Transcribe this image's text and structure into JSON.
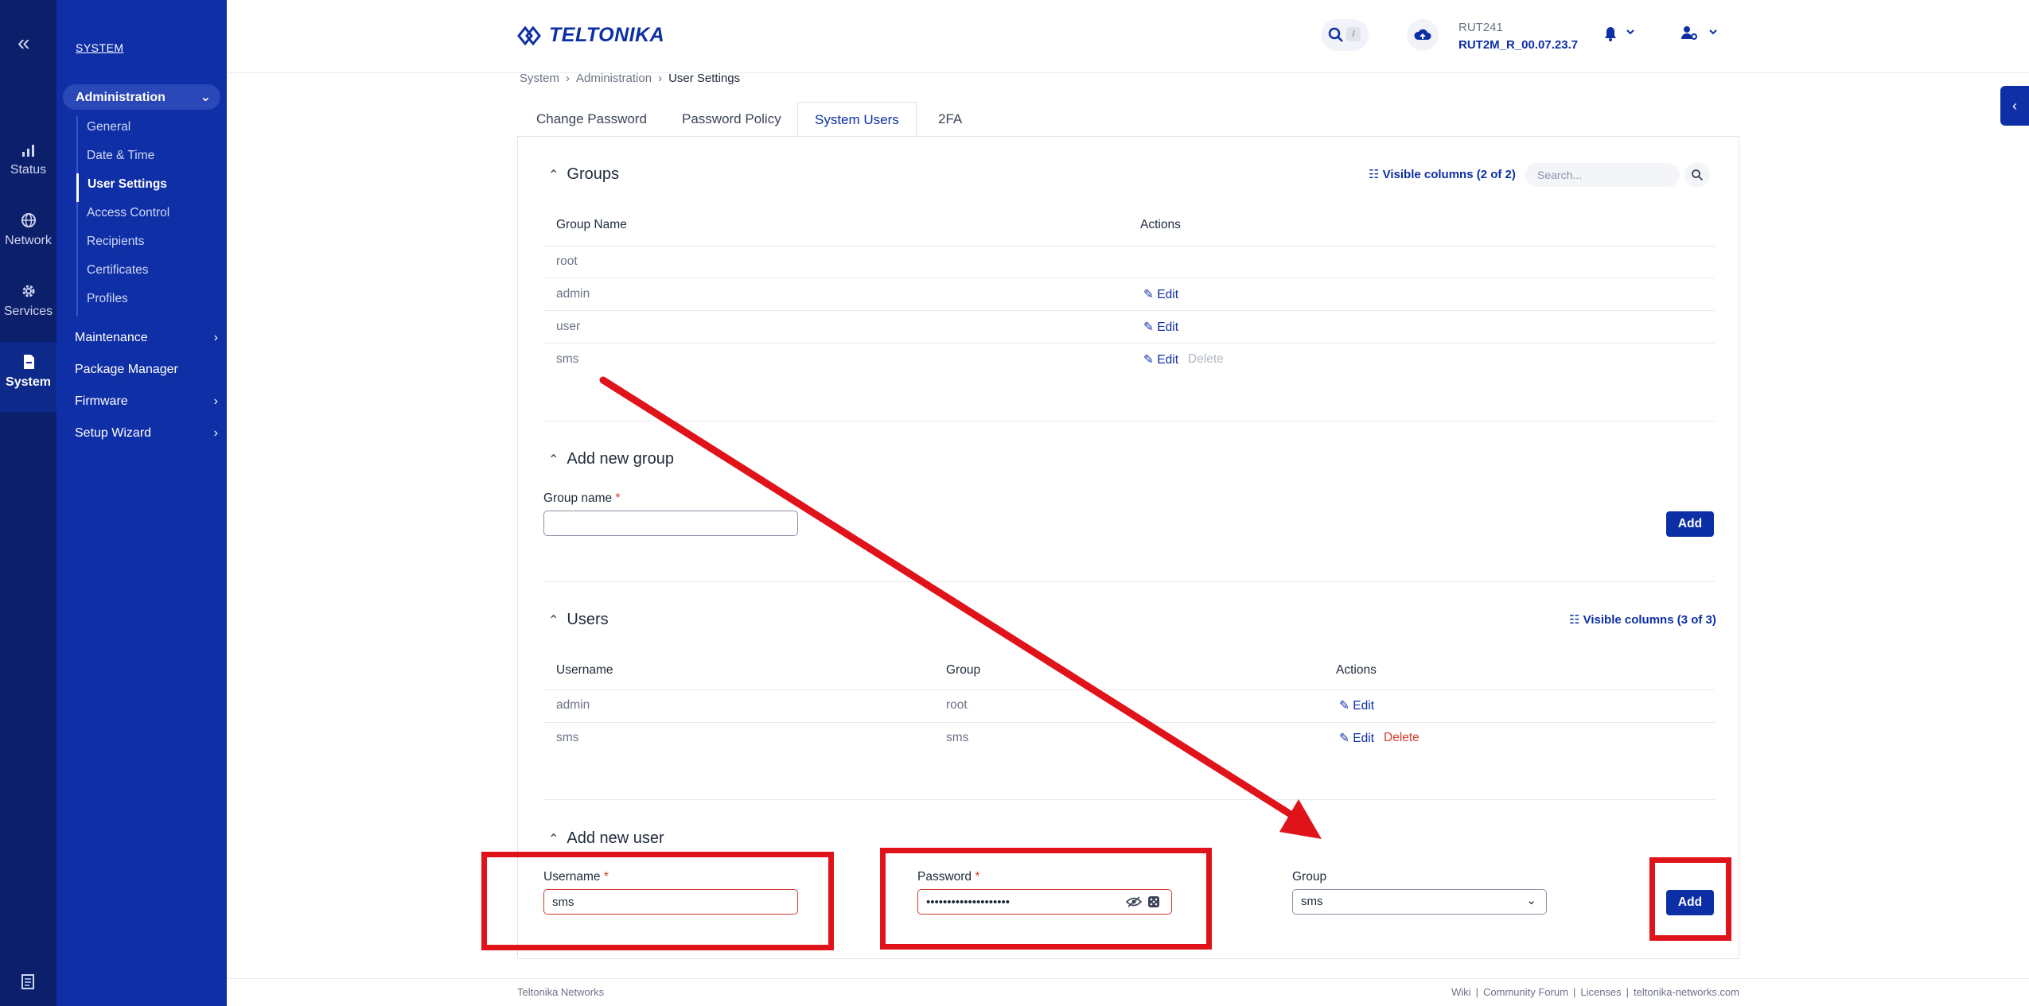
{
  "rail": {
    "items": [
      {
        "label": "Status",
        "icon": "status-chart-icon"
      },
      {
        "label": "Network",
        "icon": "globe-icon"
      },
      {
        "label": "Services",
        "icon": "gear-icon"
      },
      {
        "label": "System",
        "icon": "system-doc-icon"
      }
    ]
  },
  "nav": {
    "section": "SYSTEM",
    "group": "Administration",
    "subitems": [
      "General",
      "Date & Time",
      "User Settings",
      "Access Control",
      "Recipients",
      "Certificates",
      "Profiles"
    ],
    "active_subitem": "User Settings",
    "items": [
      "Maintenance",
      "Package Manager",
      "Firmware",
      "Setup Wizard"
    ]
  },
  "topbar": {
    "brand": "TELTONIKA",
    "search_key": "/",
    "device_model": "RUT241",
    "firmware": "RUT2M_R_00.07.23.7"
  },
  "breadcrumb": [
    "System",
    "Administration",
    "User Settings"
  ],
  "tabs": [
    "Change Password",
    "Password Policy",
    "System Users",
    "2FA"
  ],
  "active_tab": "System Users",
  "groups": {
    "title": "Groups",
    "visible_columns": "Visible columns (2 of 2)",
    "search_placeholder": "Search...",
    "columns": [
      "Group Name",
      "Actions"
    ],
    "rows": [
      {
        "name": "root",
        "edit": "",
        "delete": ""
      },
      {
        "name": "admin",
        "edit": "Edit",
        "delete": ""
      },
      {
        "name": "user",
        "edit": "Edit",
        "delete": ""
      },
      {
        "name": "sms",
        "edit": "Edit",
        "delete": "Delete"
      }
    ]
  },
  "add_group": {
    "title": "Add new group",
    "field_label": "Group name",
    "required": "*",
    "value": "",
    "button": "Add"
  },
  "users": {
    "title": "Users",
    "visible_columns": "Visible columns (3 of 3)",
    "columns": [
      "Username",
      "Group",
      "Actions"
    ],
    "rows": [
      {
        "username": "admin",
        "group": "root",
        "edit": "Edit",
        "delete": ""
      },
      {
        "username": "sms",
        "group": "sms",
        "edit": "Edit",
        "delete": "Delete"
      }
    ]
  },
  "add_user": {
    "title": "Add new user",
    "username_label": "Username",
    "username_value": "sms",
    "password_label": "Password",
    "password_value": "••••••••••••••••••••",
    "group_label": "Group",
    "group_value": "sms",
    "required": "*",
    "button": "Add"
  },
  "footer": {
    "company": "Teltonika Networks",
    "links": [
      "Wiki",
      "Community Forum",
      "Licenses",
      "teltonika-networks.com"
    ]
  },
  "colors": {
    "rail": "#0c1f6b",
    "nav": "#0f2fa6",
    "accent": "#0c2fa5",
    "danger": "#d33b2c",
    "annotation": "#e0131b"
  }
}
